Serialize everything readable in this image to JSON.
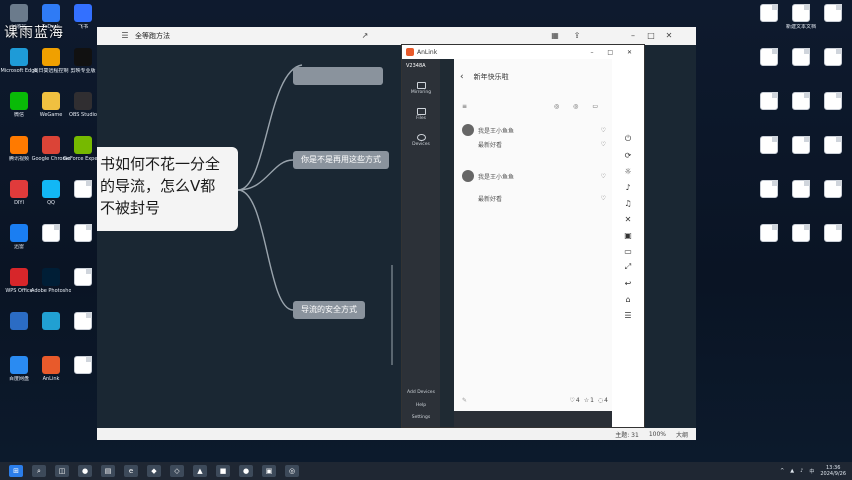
{
  "watermark": "课雨蓝海",
  "desktop": {
    "left_icons": [
      {
        "label": "回收站",
        "color": "#6b7b8c"
      },
      {
        "label": "ToDesk",
        "color": "#2f7bf5"
      },
      {
        "label": "飞书",
        "color": "#3370ff"
      },
      {
        "label": "Microsoft Edge",
        "color": "#1e9bd7"
      },
      {
        "label": "向日葵远程控制",
        "color": "#f0a000"
      },
      {
        "label": "剪映专业版",
        "color": "#111111"
      },
      {
        "label": "微信",
        "color": "#09bb07"
      },
      {
        "label": "WeGame",
        "color": "#f0c040"
      },
      {
        "label": "OBS Studio",
        "color": "#302e31"
      },
      {
        "label": "腾讯视频",
        "color": "#ff7a00"
      },
      {
        "label": "Google Chrome",
        "color": "#db4437"
      },
      {
        "label": "GeForce Experience",
        "color": "#76b900"
      },
      {
        "label": "DIYI",
        "color": "#e03b3b"
      },
      {
        "label": "QQ",
        "color": "#12b7f5"
      },
      {
        "label": "",
        "color": "#ffffff"
      },
      {
        "label": "迅雷",
        "color": "#1a7ef2"
      },
      {
        "label": "",
        "color": "#ffffff"
      },
      {
        "label": "",
        "color": "#ffffff"
      },
      {
        "label": "WPS Office",
        "color": "#d7262a"
      },
      {
        "label": "Adobe Photoshop",
        "color": "#001e36"
      },
      {
        "label": "",
        "color": "#ffffff"
      },
      {
        "label": "",
        "color": "#2b6cc4"
      },
      {
        "label": "",
        "color": "#21a0d2"
      },
      {
        "label": "",
        "color": "#ffffff"
      },
      {
        "label": "百度网盘",
        "color": "#2a8bf2"
      },
      {
        "label": "AnLink",
        "color": "#e85a2b"
      },
      {
        "label": "",
        "color": "#ffffff"
      }
    ],
    "right_icons": [
      {
        "label": "",
        "color": "#ffffff"
      },
      {
        "label": "新建文本文档",
        "color": "#ffffff"
      },
      {
        "label": "",
        "color": "#ffffff"
      },
      {
        "label": "",
        "color": "#ffffff"
      },
      {
        "label": "",
        "color": "#ffffff"
      },
      {
        "label": "",
        "color": "#ffffff"
      },
      {
        "label": "",
        "color": "#ffffff"
      },
      {
        "label": "",
        "color": "#ffffff"
      },
      {
        "label": "",
        "color": "#ffffff"
      },
      {
        "label": "",
        "color": "#ffffff"
      },
      {
        "label": "",
        "color": "#ffffff"
      },
      {
        "label": "",
        "color": "#ffffff"
      },
      {
        "label": "",
        "color": "#ffffff"
      },
      {
        "label": "",
        "color": "#ffffff"
      },
      {
        "label": "",
        "color": "#ffffff"
      },
      {
        "label": "",
        "color": "#ffffff"
      },
      {
        "label": "",
        "color": "#ffffff"
      },
      {
        "label": "",
        "color": "#ffffff"
      }
    ]
  },
  "mindmap": {
    "title": "全等跑方法",
    "root_text": "书如何不花一分全的导流，怎么V都不被封号",
    "branches": [
      {
        "label": "你是不是再用这些方式"
      },
      {
        "label": "导流的安全方式"
      }
    ],
    "status_zoom": "100%",
    "status_label": "主题: 31",
    "status_view": "大纲"
  },
  "anlink": {
    "title": "AnLink",
    "device": "V2348A",
    "side_items": [
      {
        "label": "Mirroring"
      },
      {
        "label": "Files"
      },
      {
        "label": "Devices"
      }
    ],
    "bottom_items": [
      {
        "label": "Add Devices"
      },
      {
        "label": "Help"
      },
      {
        "label": "Settings"
      }
    ]
  },
  "phone": {
    "header": "新年快乐啦",
    "comment1": "我是王小鱼鱼",
    "comment2": "最新好看",
    "bar_counts": [
      "4",
      "1",
      "4"
    ]
  },
  "taskbar": {
    "time": "13:36",
    "date": "2024/9/26"
  }
}
